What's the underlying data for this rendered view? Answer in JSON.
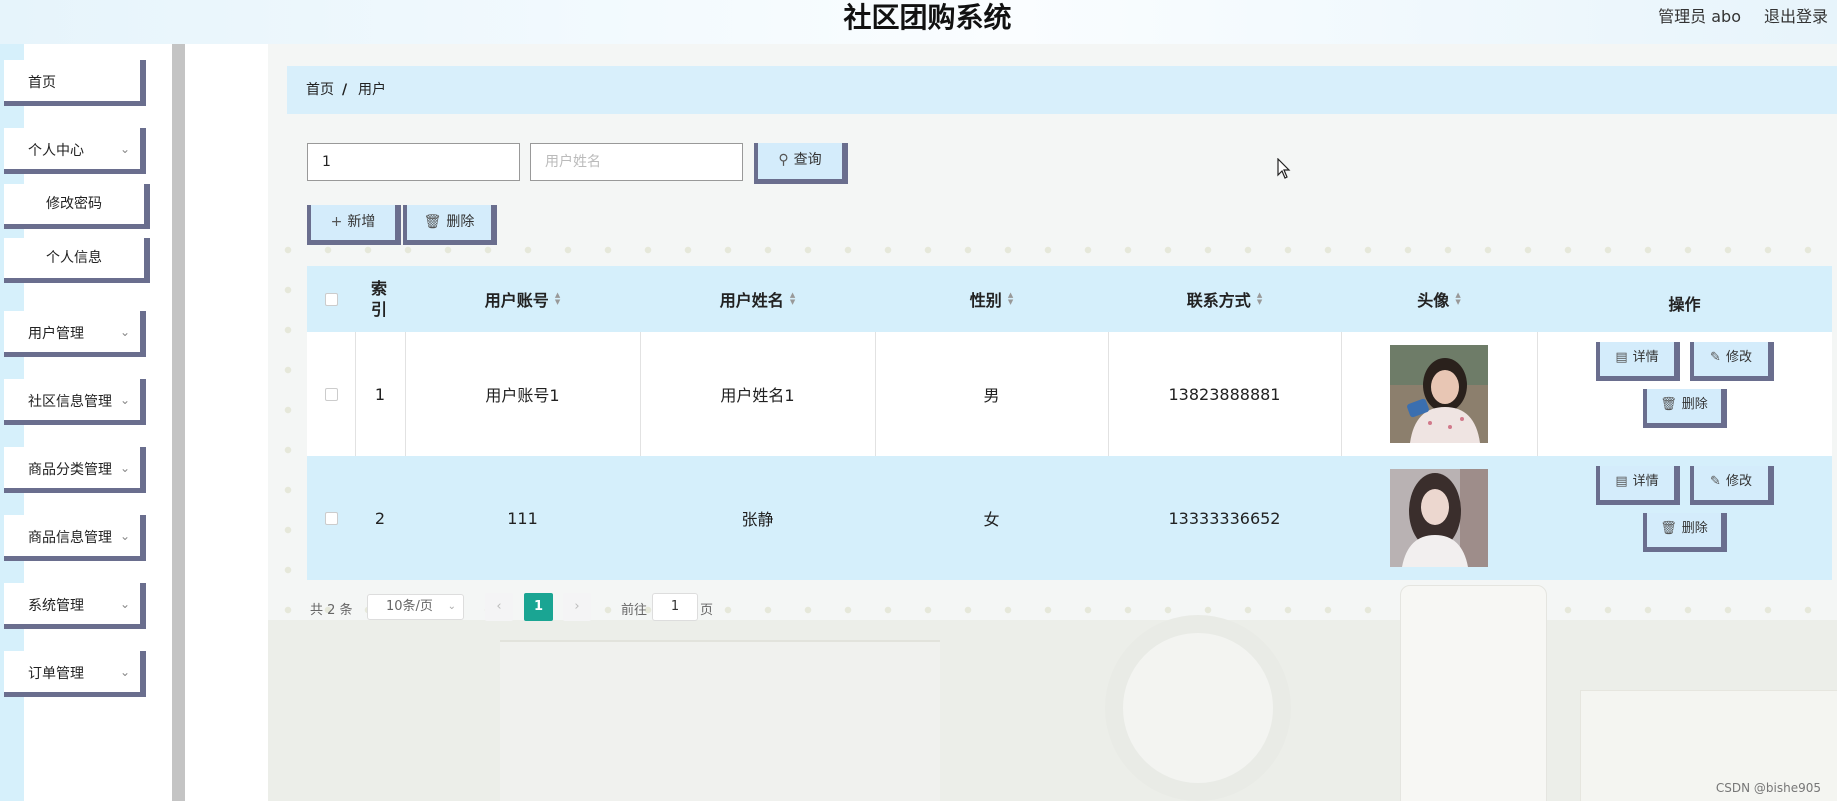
{
  "header": {
    "title": "社区团购系统",
    "user": "管理员 abo",
    "logout": "退出登录"
  },
  "sidebar": {
    "items": [
      {
        "label": "首页",
        "expandable": false
      },
      {
        "label": "个人中心",
        "expandable": true,
        "children": [
          "修改密码",
          "个人信息"
        ]
      },
      {
        "label": "用户管理",
        "expandable": true
      },
      {
        "label": "社区信息管理",
        "expandable": true
      },
      {
        "label": "商品分类管理",
        "expandable": true
      },
      {
        "label": "商品信息管理",
        "expandable": true
      },
      {
        "label": "系统管理",
        "expandable": true
      },
      {
        "label": "订单管理",
        "expandable": true
      }
    ]
  },
  "breadcrumb": {
    "home": "首页",
    "separator": "/",
    "current": "用户"
  },
  "search": {
    "account_value": "1",
    "name_placeholder": "用户姓名",
    "query_label": "查询"
  },
  "actions": {
    "add_label": "新增",
    "delete_label": "删除"
  },
  "table": {
    "columns": [
      "索引",
      "用户账号",
      "用户姓名",
      "性别",
      "联系方式",
      "头像",
      "操作"
    ],
    "rows": [
      {
        "index": "1",
        "account": "用户账号1",
        "name": "用户姓名1",
        "gender": "男",
        "phone": "13823888881"
      },
      {
        "index": "2",
        "account": "111",
        "name": "张静",
        "gender": "女",
        "phone": "13333336652"
      }
    ],
    "row_actions": {
      "detail": "详情",
      "edit": "修改",
      "delete": "删除"
    }
  },
  "pagination": {
    "total": "共 2 条",
    "page_size": "10条/页",
    "current_page": "1",
    "goto_label": "前往",
    "goto_value": "1",
    "page_unit": "页"
  },
  "watermark": "CSDN @bishe905",
  "colors": {
    "accent_light": "#d5effb",
    "button_border": "#6a6e8e",
    "pager_active": "#1aa593"
  }
}
